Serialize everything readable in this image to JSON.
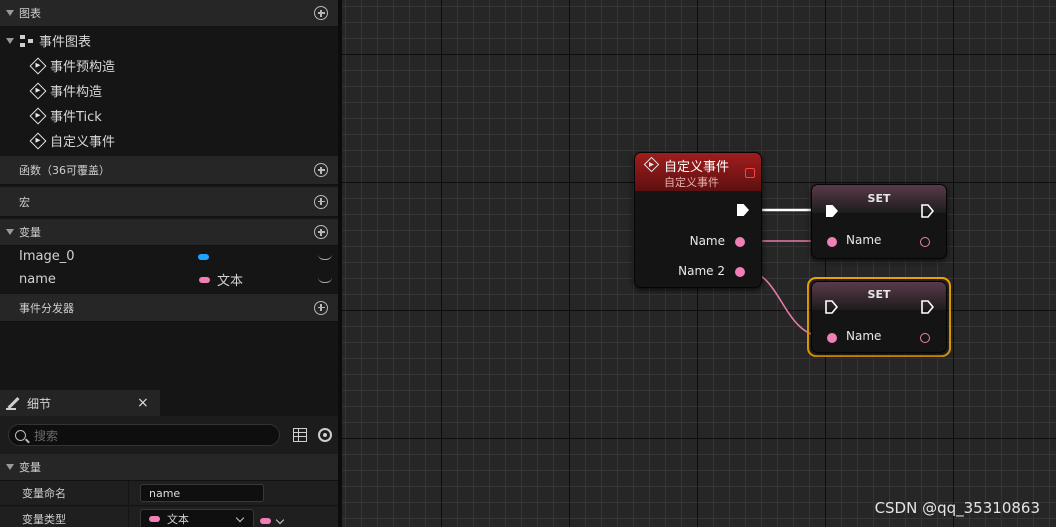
{
  "my_blueprint": {
    "graphs": {
      "label": "图表"
    },
    "event_graph": {
      "label": "事件图表",
      "items": [
        {
          "label": "事件预构造"
        },
        {
          "label": "事件构造"
        },
        {
          "label": "事件Tick"
        },
        {
          "label": "自定义事件"
        }
      ]
    },
    "functions": {
      "label": "函数（36可覆盖）"
    },
    "macros": {
      "label": "宏"
    },
    "variables": {
      "label": "变量",
      "items": [
        {
          "name": "Image_0",
          "color": "#1fa3ff",
          "type": ""
        },
        {
          "name": "name",
          "color": "#f07fb6",
          "type": "文本"
        }
      ]
    },
    "dispatchers": {
      "label": "事件分发器"
    }
  },
  "details": {
    "tab_label": "细节",
    "close": "×",
    "search_placeholder": "搜索",
    "section": "变量",
    "props": [
      {
        "label": "变量命名",
        "value": "name"
      },
      {
        "label": "变量类型",
        "value": "文本"
      }
    ]
  },
  "graph": {
    "custom_event_node": {
      "title": "自定义事件",
      "subtitle": "自定义事件",
      "pins": [
        {
          "label": "Name"
        },
        {
          "label": "Name 2"
        }
      ]
    },
    "set_node_1": {
      "title": "SET",
      "pin": "Name"
    },
    "set_node_2": {
      "title": "SET",
      "pin": "Name",
      "selected": true
    },
    "pin_color": "#f07fb6",
    "event_header_color": "#8a1a1a",
    "selection_color": "#f2a400"
  },
  "watermark": "CSDN @qq_35310863"
}
